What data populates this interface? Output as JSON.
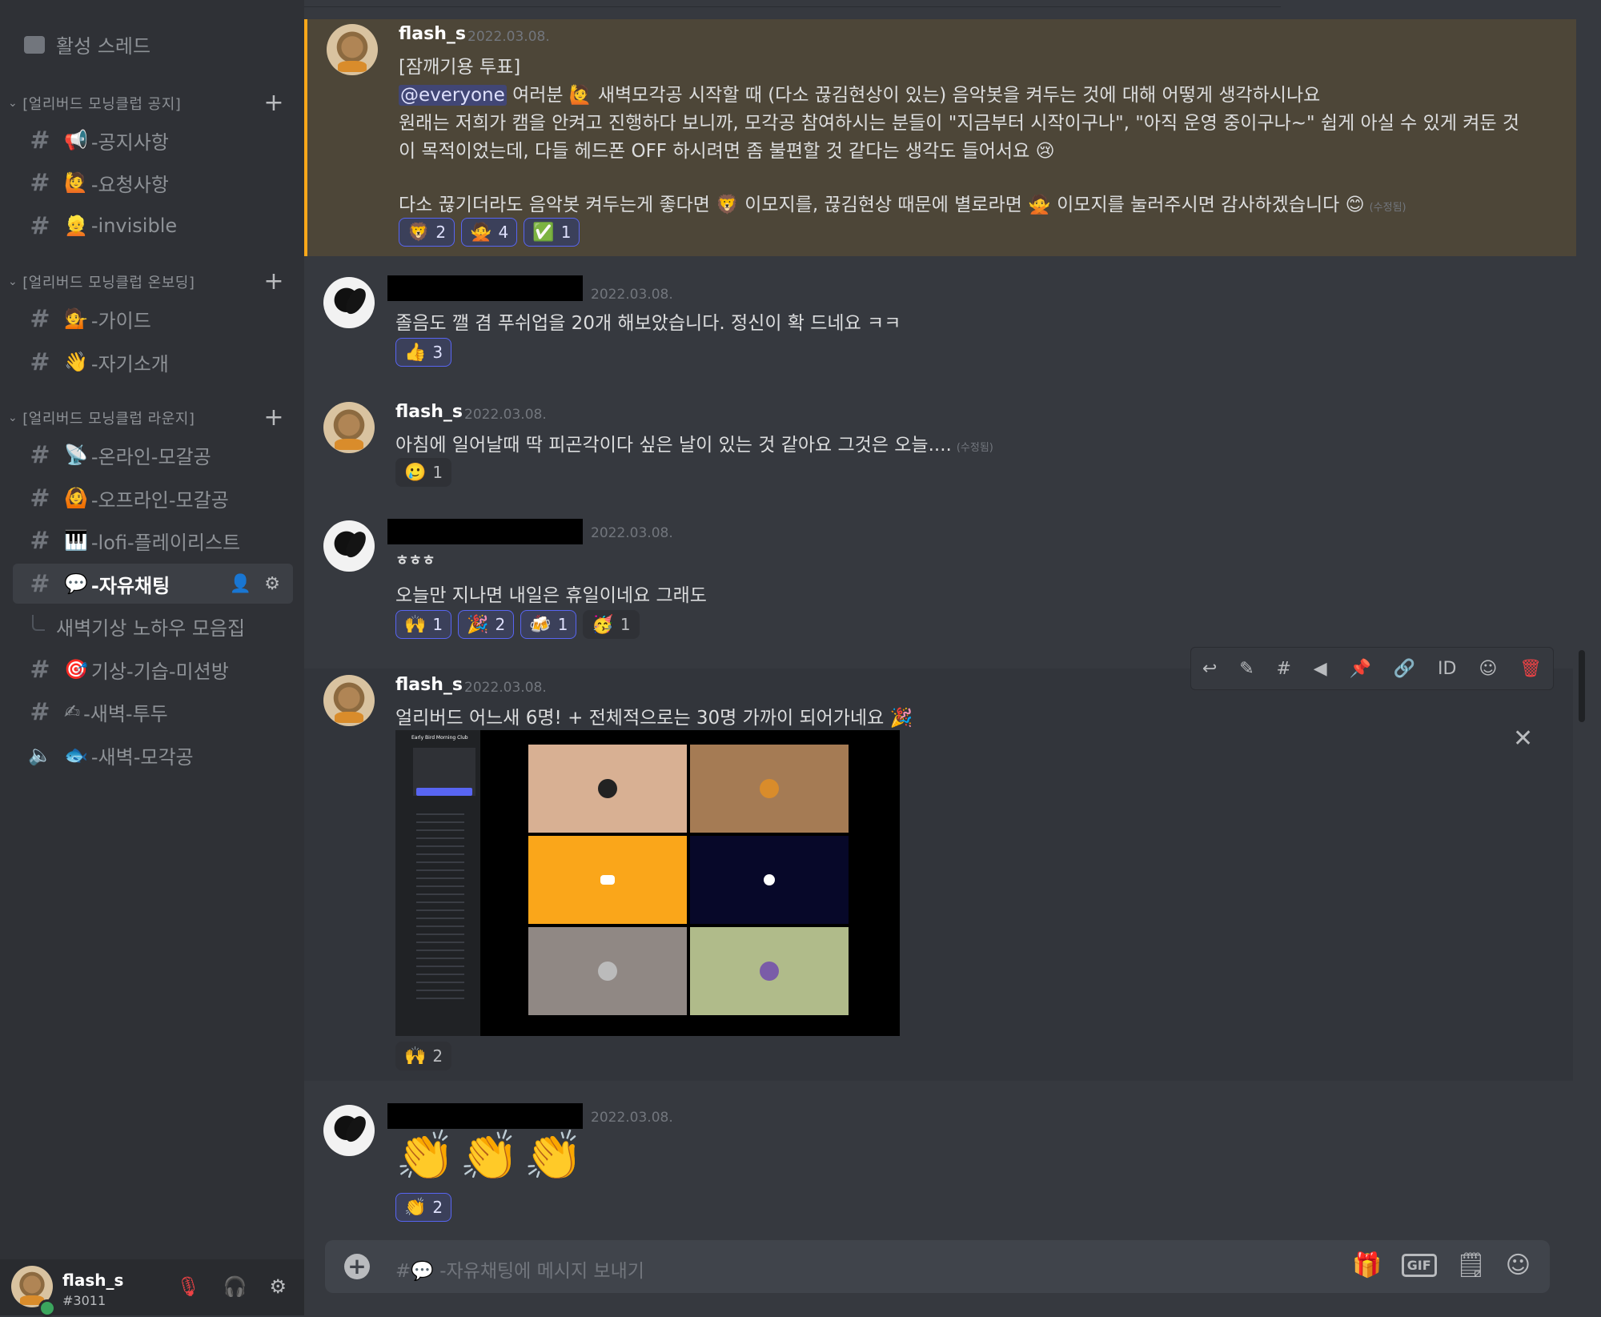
{
  "sidebar": {
    "top_item": "활성 스레드",
    "categories": [
      {
        "label": "[얼리버드 모닝클럽 공지]"
      },
      {
        "label": "[얼리버드 모닝클럽 온보딩]"
      },
      {
        "label": "[얼리버드 모닝클럽 라운지]"
      }
    ],
    "channels": [
      {
        "emoji": "📢",
        "label": "-공지사항"
      },
      {
        "emoji": "🙋",
        "label": "-요청사항"
      },
      {
        "emoji": "👱",
        "label": "-invisible"
      },
      {
        "emoji": "💁",
        "label": "-가이드"
      },
      {
        "emoji": "👋",
        "label": "-자기소개"
      },
      {
        "emoji": "📡",
        "label": "-온라인-모갈공"
      },
      {
        "emoji": "🙆",
        "label": "-오프라인-모갈공"
      },
      {
        "emoji": "🎹",
        "label": "-lofi-플레이리스트"
      },
      {
        "emoji": "💬",
        "label": "-자유채팅"
      },
      {
        "emoji": "",
        "label": "새벽기상 노하우 모음집"
      },
      {
        "emoji": "🎯",
        "label": "기상-기습-미션방"
      },
      {
        "emoji": "✍",
        "label": "-새벽-투두"
      },
      {
        "emoji": "🐟",
        "label": "-새벽-모각공"
      }
    ]
  },
  "user_panel": {
    "name": "flash_s",
    "tag": "#3011"
  },
  "messages": [
    {
      "author": "flash_s",
      "timestamp": "2022.03.08.",
      "line1": "[잠깨기용 투표]",
      "mention": "@everyone",
      "line2_rest": "여러분 🙋 새벽모각공 시작할 때 (다소 끊김현상이 있는) 음악봇을 켜두는 것에 대해 어떻게 생각하시나요",
      "line3": "원래는 저희가 캠을 안켜고 진행하다 보니까, 모각공 참여하시는 분들이 \"지금부터 시작이구나\",  \"아직 운영 중이구나~\" 쉽게 아실 수 있게 켜둔 것",
      "line4": "이 목적이었는데, 다들 헤드폰 OFF 하시려면 좀 불편할 것 같다는 생각도 들어서요 😢",
      "line5": "다소 끊기더라도 음악봇 켜두는게 좋다면 🦁 이모지를, 끊김현상 때문에 별로라면 🙅 이모지를 눌러주시면 감사하겠습니다 😊",
      "edited": "(수정됨)",
      "reactions": [
        {
          "emoji": "🦁",
          "count": "2"
        },
        {
          "emoji": "🙅",
          "count": "4"
        },
        {
          "emoji": "✅",
          "count": "1"
        }
      ]
    },
    {
      "timestamp": "2022.03.08.",
      "line1": "졸음도 깰 겸 푸쉬업을 20개 해보았습니다. 정신이 확 드네요 ㅋㅋ",
      "reactions": [
        {
          "emoji": "👍",
          "count": "3"
        }
      ]
    },
    {
      "author": "flash_s",
      "timestamp": "2022.03.08.",
      "line1": "아침에 일어날때 딱 피곤각이다 싶은 날이 있는 것 같아요 그것은 오늘....",
      "edited": "(수정됨)",
      "reactions": [
        {
          "emoji": "🥲",
          "count": "1"
        }
      ]
    },
    {
      "timestamp": "2022.03.08.",
      "line1": "ㅎㅎㅎ",
      "line2": "오늘만 지나면 내일은 휴일이네요 그래도",
      "reactions": [
        {
          "emoji": "🙌",
          "count": "1"
        },
        {
          "emoji": "🎉",
          "count": "2"
        },
        {
          "emoji": "🍻",
          "count": "1"
        },
        {
          "emoji": "🥳",
          "count": "1"
        }
      ]
    },
    {
      "author": "flash_s",
      "timestamp": "2022.03.08.",
      "line1": "얼리버드 어느새 6명! + 전체적으로는 30명 가까이 되어가네요 🎉",
      "image_title": "Early Bird Morning Club",
      "reactions": [
        {
          "emoji": "🙌",
          "count": "2"
        }
      ]
    },
    {
      "timestamp": "2022.03.08.",
      "big_emoji": [
        "👏",
        "👏",
        "👏"
      ],
      "reactions": [
        {
          "emoji": "👏",
          "count": "2"
        }
      ]
    }
  ],
  "composer": {
    "placeholder": "#💬 -자유채팅에 메시지 보내기",
    "gif_label": "GIF"
  },
  "colors": {
    "highlight_bg": "#4d4638",
    "highlight_border": "#faa81a",
    "mention": "#414675",
    "danger": "#ed4245"
  }
}
